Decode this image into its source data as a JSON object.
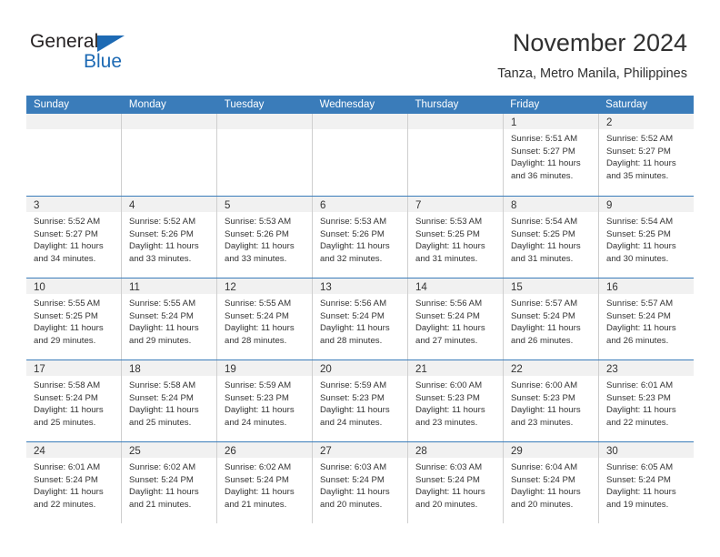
{
  "brand": {
    "name_part1": "General",
    "name_part2": "Blue",
    "logo_icon": "blue-triangle-icon",
    "colors": {
      "blue": "#1d6ab4",
      "dark": "#231f20"
    }
  },
  "header": {
    "title": "November 2024",
    "subtitle": "Tanza, Metro Manila, Philippines"
  },
  "theme": {
    "header_blue": "#3a7cba",
    "daynum_bar": "#f1f1f1",
    "cell_border": "#cfcfcf",
    "text": "#333333"
  },
  "calendar": {
    "day_headers": [
      "Sunday",
      "Monday",
      "Tuesday",
      "Wednesday",
      "Thursday",
      "Friday",
      "Saturday"
    ],
    "weeks": [
      [
        {
          "day": "",
          "lines": []
        },
        {
          "day": "",
          "lines": []
        },
        {
          "day": "",
          "lines": []
        },
        {
          "day": "",
          "lines": []
        },
        {
          "day": "",
          "lines": []
        },
        {
          "day": "1",
          "lines": [
            "Sunrise: 5:51 AM",
            "Sunset: 5:27 PM",
            "Daylight: 11 hours",
            "and 36 minutes."
          ]
        },
        {
          "day": "2",
          "lines": [
            "Sunrise: 5:52 AM",
            "Sunset: 5:27 PM",
            "Daylight: 11 hours",
            "and 35 minutes."
          ]
        }
      ],
      [
        {
          "day": "3",
          "lines": [
            "Sunrise: 5:52 AM",
            "Sunset: 5:27 PM",
            "Daylight: 11 hours",
            "and 34 minutes."
          ]
        },
        {
          "day": "4",
          "lines": [
            "Sunrise: 5:52 AM",
            "Sunset: 5:26 PM",
            "Daylight: 11 hours",
            "and 33 minutes."
          ]
        },
        {
          "day": "5",
          "lines": [
            "Sunrise: 5:53 AM",
            "Sunset: 5:26 PM",
            "Daylight: 11 hours",
            "and 33 minutes."
          ]
        },
        {
          "day": "6",
          "lines": [
            "Sunrise: 5:53 AM",
            "Sunset: 5:26 PM",
            "Daylight: 11 hours",
            "and 32 minutes."
          ]
        },
        {
          "day": "7",
          "lines": [
            "Sunrise: 5:53 AM",
            "Sunset: 5:25 PM",
            "Daylight: 11 hours",
            "and 31 minutes."
          ]
        },
        {
          "day": "8",
          "lines": [
            "Sunrise: 5:54 AM",
            "Sunset: 5:25 PM",
            "Daylight: 11 hours",
            "and 31 minutes."
          ]
        },
        {
          "day": "9",
          "lines": [
            "Sunrise: 5:54 AM",
            "Sunset: 5:25 PM",
            "Daylight: 11 hours",
            "and 30 minutes."
          ]
        }
      ],
      [
        {
          "day": "10",
          "lines": [
            "Sunrise: 5:55 AM",
            "Sunset: 5:25 PM",
            "Daylight: 11 hours",
            "and 29 minutes."
          ]
        },
        {
          "day": "11",
          "lines": [
            "Sunrise: 5:55 AM",
            "Sunset: 5:24 PM",
            "Daylight: 11 hours",
            "and 29 minutes."
          ]
        },
        {
          "day": "12",
          "lines": [
            "Sunrise: 5:55 AM",
            "Sunset: 5:24 PM",
            "Daylight: 11 hours",
            "and 28 minutes."
          ]
        },
        {
          "day": "13",
          "lines": [
            "Sunrise: 5:56 AM",
            "Sunset: 5:24 PM",
            "Daylight: 11 hours",
            "and 28 minutes."
          ]
        },
        {
          "day": "14",
          "lines": [
            "Sunrise: 5:56 AM",
            "Sunset: 5:24 PM",
            "Daylight: 11 hours",
            "and 27 minutes."
          ]
        },
        {
          "day": "15",
          "lines": [
            "Sunrise: 5:57 AM",
            "Sunset: 5:24 PM",
            "Daylight: 11 hours",
            "and 26 minutes."
          ]
        },
        {
          "day": "16",
          "lines": [
            "Sunrise: 5:57 AM",
            "Sunset: 5:24 PM",
            "Daylight: 11 hours",
            "and 26 minutes."
          ]
        }
      ],
      [
        {
          "day": "17",
          "lines": [
            "Sunrise: 5:58 AM",
            "Sunset: 5:24 PM",
            "Daylight: 11 hours",
            "and 25 minutes."
          ]
        },
        {
          "day": "18",
          "lines": [
            "Sunrise: 5:58 AM",
            "Sunset: 5:24 PM",
            "Daylight: 11 hours",
            "and 25 minutes."
          ]
        },
        {
          "day": "19",
          "lines": [
            "Sunrise: 5:59 AM",
            "Sunset: 5:23 PM",
            "Daylight: 11 hours",
            "and 24 minutes."
          ]
        },
        {
          "day": "20",
          "lines": [
            "Sunrise: 5:59 AM",
            "Sunset: 5:23 PM",
            "Daylight: 11 hours",
            "and 24 minutes."
          ]
        },
        {
          "day": "21",
          "lines": [
            "Sunrise: 6:00 AM",
            "Sunset: 5:23 PM",
            "Daylight: 11 hours",
            "and 23 minutes."
          ]
        },
        {
          "day": "22",
          "lines": [
            "Sunrise: 6:00 AM",
            "Sunset: 5:23 PM",
            "Daylight: 11 hours",
            "and 23 minutes."
          ]
        },
        {
          "day": "23",
          "lines": [
            "Sunrise: 6:01 AM",
            "Sunset: 5:23 PM",
            "Daylight: 11 hours",
            "and 22 minutes."
          ]
        }
      ],
      [
        {
          "day": "24",
          "lines": [
            "Sunrise: 6:01 AM",
            "Sunset: 5:24 PM",
            "Daylight: 11 hours",
            "and 22 minutes."
          ]
        },
        {
          "day": "25",
          "lines": [
            "Sunrise: 6:02 AM",
            "Sunset: 5:24 PM",
            "Daylight: 11 hours",
            "and 21 minutes."
          ]
        },
        {
          "day": "26",
          "lines": [
            "Sunrise: 6:02 AM",
            "Sunset: 5:24 PM",
            "Daylight: 11 hours",
            "and 21 minutes."
          ]
        },
        {
          "day": "27",
          "lines": [
            "Sunrise: 6:03 AM",
            "Sunset: 5:24 PM",
            "Daylight: 11 hours",
            "and 20 minutes."
          ]
        },
        {
          "day": "28",
          "lines": [
            "Sunrise: 6:03 AM",
            "Sunset: 5:24 PM",
            "Daylight: 11 hours",
            "and 20 minutes."
          ]
        },
        {
          "day": "29",
          "lines": [
            "Sunrise: 6:04 AM",
            "Sunset: 5:24 PM",
            "Daylight: 11 hours",
            "and 20 minutes."
          ]
        },
        {
          "day": "30",
          "lines": [
            "Sunrise: 6:05 AM",
            "Sunset: 5:24 PM",
            "Daylight: 11 hours",
            "and 19 minutes."
          ]
        }
      ]
    ]
  }
}
